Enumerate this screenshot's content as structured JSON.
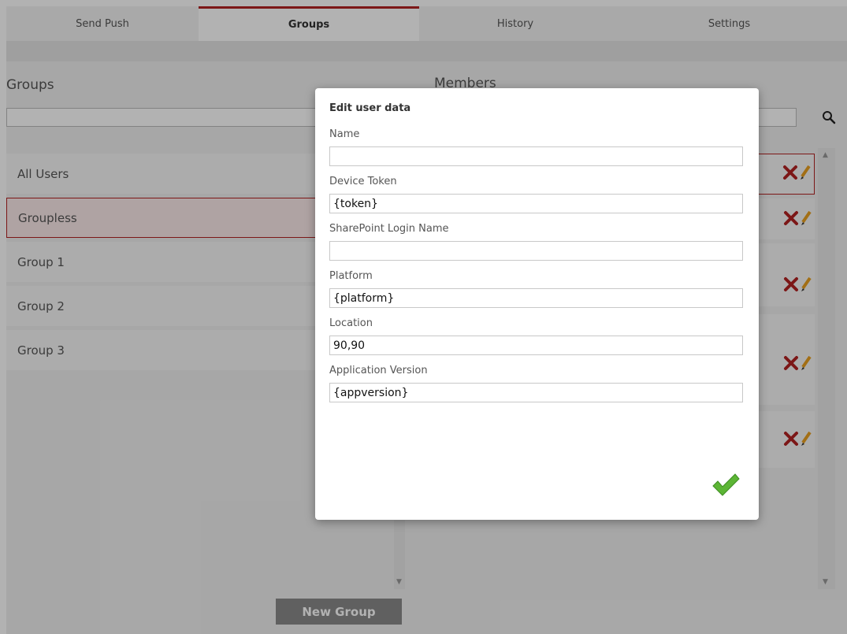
{
  "tabs": [
    {
      "label": "Send Push"
    },
    {
      "label": "Groups"
    },
    {
      "label": "History"
    },
    {
      "label": "Settings"
    }
  ],
  "left_panel": {
    "title": "Groups",
    "search_value": "",
    "groups": [
      {
        "label": "All Users"
      },
      {
        "label": "Groupless"
      },
      {
        "label": "Group 1"
      },
      {
        "label": "Group 2"
      },
      {
        "label": "Group 3"
      }
    ],
    "new_group_label": "New Group"
  },
  "right_panel": {
    "title": "Members",
    "search_value": "",
    "icons": {
      "search": "search-icon",
      "delete": "delete-x-icon",
      "edit": "pencil-edit-icon"
    }
  },
  "modal": {
    "title": "Edit user data",
    "fields": [
      {
        "label": "Name",
        "value": ""
      },
      {
        "label": "Device Token",
        "value": "{token}"
      },
      {
        "label": "SharePoint Login Name",
        "value": ""
      },
      {
        "label": "Platform",
        "value": "{platform}"
      },
      {
        "label": "Location",
        "value": "90,90"
      },
      {
        "label": "Application Version",
        "value": "{appversion}"
      }
    ],
    "confirm_icon": "green-checkmark-icon"
  },
  "colors": {
    "accent": "#b22222",
    "check": "#5cb535",
    "delete": "#b22222",
    "edit": "#e8a020"
  }
}
